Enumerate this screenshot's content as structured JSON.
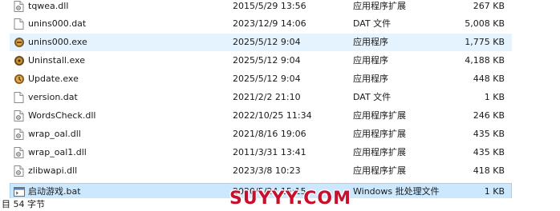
{
  "files": [
    {
      "name": "tqwea.dll",
      "date": "2015/5/29 13:56",
      "type": "应用程序扩展",
      "size": "267 KB",
      "icon": "dll-file-icon"
    },
    {
      "name": "unins000.dat",
      "date": "2023/12/9 14:06",
      "type": "DAT 文件",
      "size": "5,008 KB",
      "icon": "dat-file-icon"
    },
    {
      "name": "unins000.exe",
      "date": "2025/5/12 9:04",
      "type": "应用程序",
      "size": "1,775 KB",
      "icon": "uninstaller-icon"
    },
    {
      "name": "Uninstall.exe",
      "date": "2025/5/12 9:04",
      "type": "应用程序",
      "size": "4,188 KB",
      "icon": "uninstall-app-icon"
    },
    {
      "name": "Update.exe",
      "date": "2025/5/12 9:04",
      "type": "应用程序",
      "size": "448 KB",
      "icon": "update-app-icon"
    },
    {
      "name": "version.dat",
      "date": "2021/2/2 21:10",
      "type": "DAT 文件",
      "size": "1 KB",
      "icon": "dat-file-icon"
    },
    {
      "name": "WordsCheck.dll",
      "date": "2022/10/25 11:34",
      "type": "应用程序扩展",
      "size": "246 KB",
      "icon": "dll-file-icon"
    },
    {
      "name": "wrap_oal.dll",
      "date": "2021/8/16 19:06",
      "type": "应用程序扩展",
      "size": "435 KB",
      "icon": "dll-file-icon"
    },
    {
      "name": "wrap_oal1.dll",
      "date": "2011/3/31 13:41",
      "type": "应用程序扩展",
      "size": "435 KB",
      "icon": "dll-file-icon"
    },
    {
      "name": "zlibwapi.dll",
      "date": "2023/3/8 10:23",
      "type": "应用程序扩展",
      "size": "418 KB",
      "icon": "dll-file-icon"
    },
    {
      "name": "启动游戏.bat",
      "date": "2020/5/24 15:15",
      "type": "Windows 批处理文件",
      "size": "1 KB",
      "icon": "batch-file-icon"
    }
  ],
  "hover_index": 2,
  "selected_index": 10,
  "statusbar": {
    "text": "目 54 字节"
  },
  "watermark": {
    "text": "SUYYY.COM"
  },
  "colors": {
    "hover": "#e5f3ff",
    "selected": "#cce8ff",
    "selected_border": "#99d1ff"
  }
}
